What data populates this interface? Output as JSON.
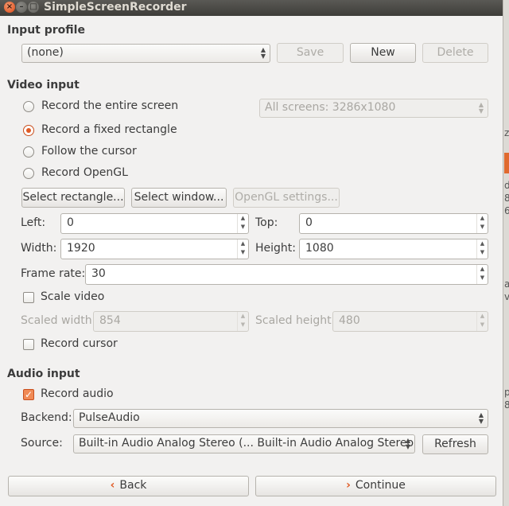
{
  "window": {
    "title": "SimpleScreenRecorder",
    "close_glyph": "×",
    "minimize_glyph": "–",
    "maximize_glyph": "□"
  },
  "input_profile": {
    "heading": "Input profile",
    "selected": "(none)",
    "save_label": "Save",
    "new_label": "New",
    "delete_label": "Delete"
  },
  "video_input": {
    "heading": "Video input",
    "option_entire_screen": "Record the entire screen",
    "option_fixed_rectangle": "Record a fixed rectangle",
    "option_follow_cursor": "Follow the cursor",
    "option_opengl": "Record OpenGL",
    "selected_option": "Record a fixed rectangle",
    "screens_combo": "All screens: 3286x1080",
    "select_rectangle_label": "Select rectangle...",
    "select_window_label": "Select window...",
    "opengl_settings_label": "OpenGL settings...",
    "left_label": "Left:",
    "left_value": "0",
    "top_label": "Top:",
    "top_value": "0",
    "width_label": "Width:",
    "width_value": "1920",
    "height_label": "Height:",
    "height_value": "1080",
    "frame_rate_label": "Frame rate:",
    "frame_rate_value": "30",
    "scale_video_label": "Scale video",
    "scale_video_checked": false,
    "scaled_width_label": "Scaled width:",
    "scaled_width_value": "854",
    "scaled_height_label": "Scaled height:",
    "scaled_height_value": "480",
    "record_cursor_label": "Record cursor",
    "record_cursor_checked": false
  },
  "audio_input": {
    "heading": "Audio input",
    "record_audio_label": "Record audio",
    "record_audio_checked": true,
    "check_glyph": "✓",
    "backend_label": "Backend:",
    "backend_value": "PulseAudio",
    "source_label": "Source:",
    "source_value": "Built-in Audio Analog Stereo (... Built-in Audio Analog Stereo)",
    "refresh_label": "Refresh"
  },
  "footer": {
    "back_label": "Back",
    "continue_label": "Continue",
    "back_icon": "‹",
    "continue_icon": "›"
  },
  "background_window_fragments": [
    "zo",
    "d-",
    "8",
    "6",
    "ar",
    "v",
    "p",
    "8"
  ],
  "colors": {
    "accent": "#e05a24",
    "window_bg": "#f2f1f0",
    "titlebar": "#3e3d39"
  }
}
